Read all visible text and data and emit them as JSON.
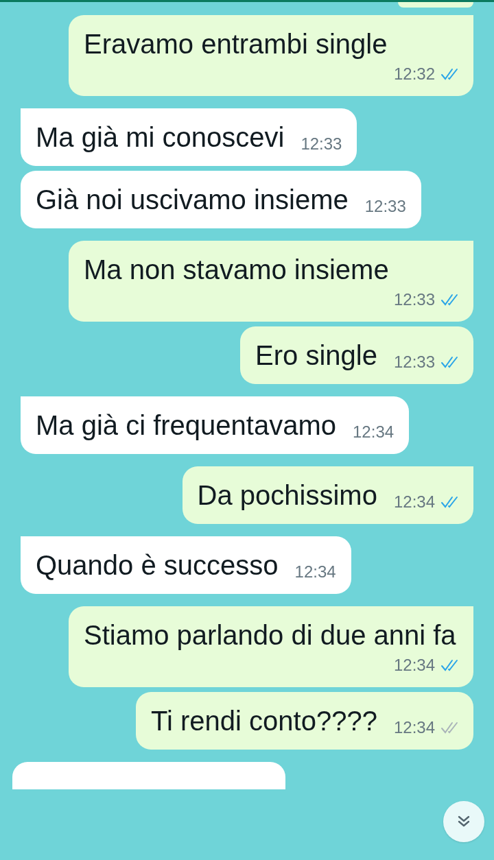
{
  "messages": [
    {
      "kind": "sent",
      "text": "Eravamo entrambi single",
      "time": "12:32",
      "read": true,
      "tail": true
    },
    {
      "kind": "received",
      "text": "Ma già mi conoscevi",
      "time": "12:33",
      "tail": true
    },
    {
      "kind": "received",
      "text": "Già noi uscivamo insieme",
      "time": "12:33",
      "tail": false
    },
    {
      "kind": "sent",
      "text": "Ma non stavamo insieme",
      "time": "12:33",
      "read": true,
      "tail": true
    },
    {
      "kind": "sent",
      "text": "Ero single",
      "time": "12:33",
      "read": true,
      "tail": false
    },
    {
      "kind": "received",
      "text": "Ma già ci frequentavamo",
      "time": "12:34",
      "tail": true
    },
    {
      "kind": "sent",
      "text": "Da pochissimo",
      "time": "12:34",
      "read": true,
      "tail": true
    },
    {
      "kind": "received",
      "text": "Quando è successo",
      "time": "12:34",
      "tail": true
    },
    {
      "kind": "sent",
      "text": "Stiamo parlando di due anni fa",
      "time": "12:34",
      "read": true,
      "tail": true
    },
    {
      "kind": "sent",
      "text": "Ti rendi conto????",
      "time": "12:34",
      "read": false,
      "tail": false
    }
  ]
}
